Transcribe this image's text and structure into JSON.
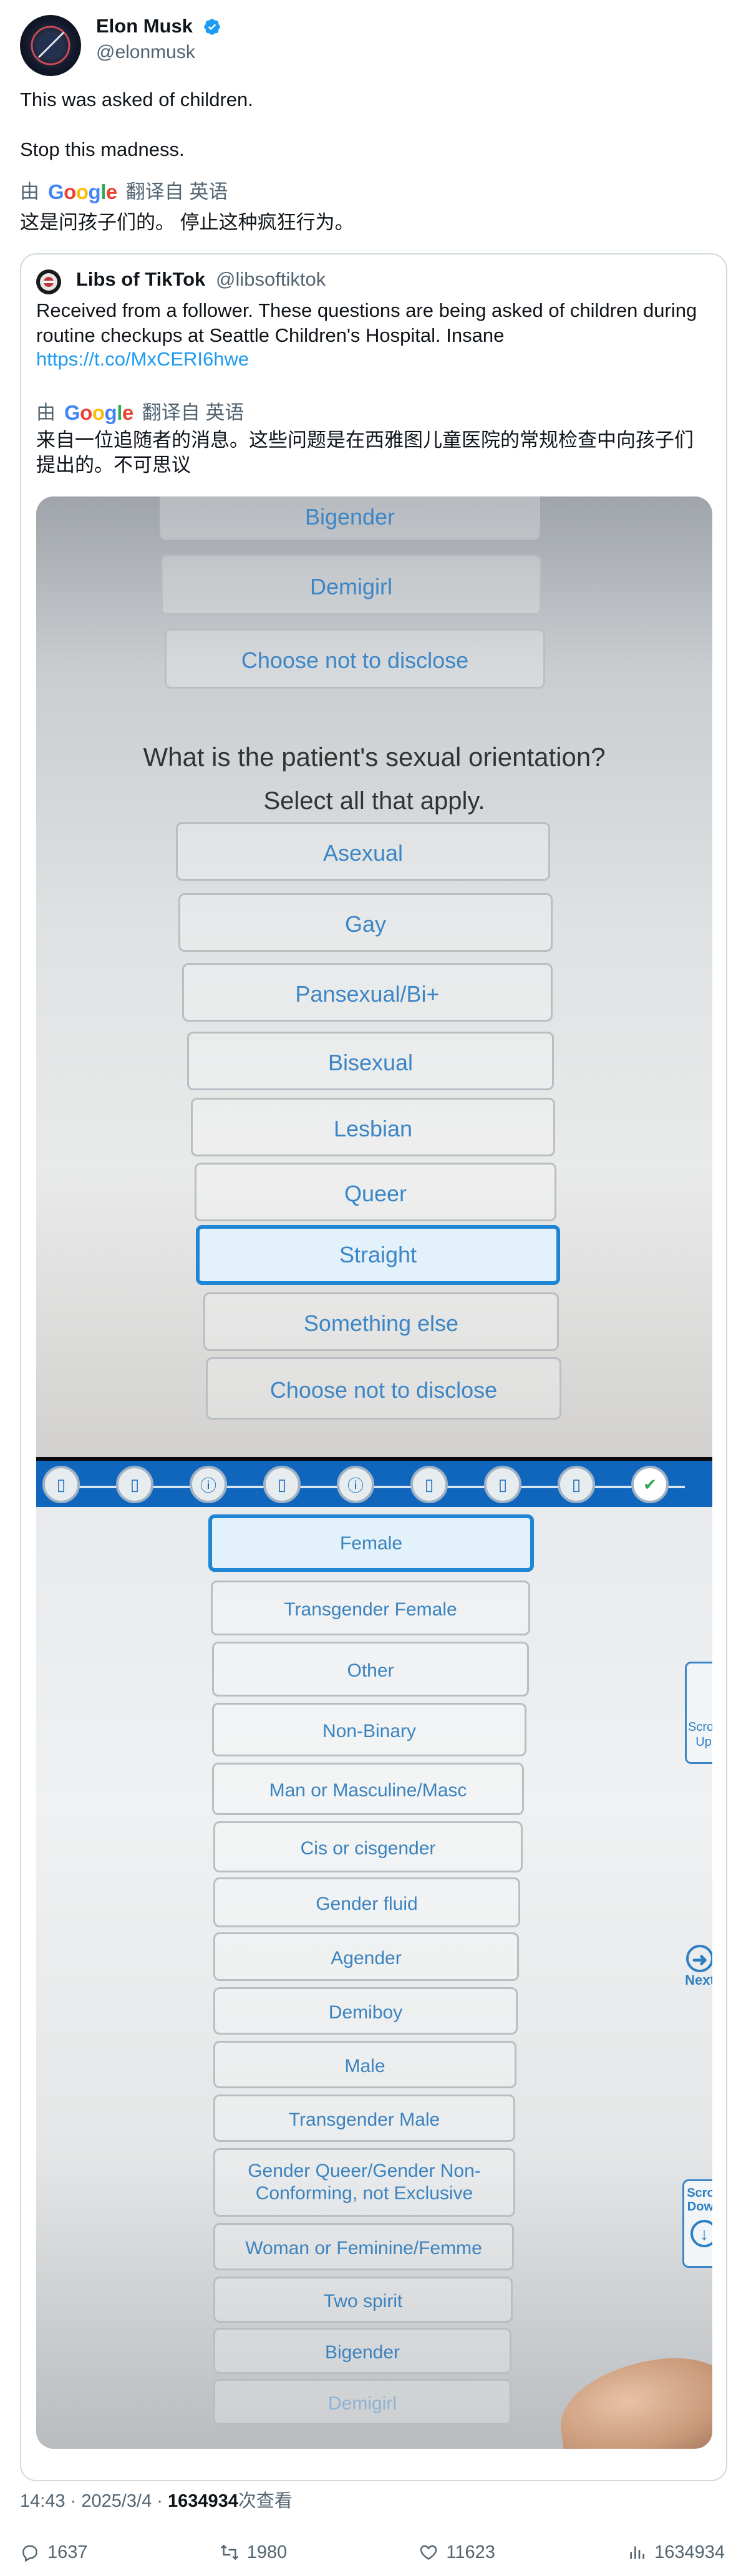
{
  "tweet": {
    "author_name": "Elon Musk",
    "author_handle": "@elonmusk",
    "text": "This was asked of children.\n\nStop this madness.",
    "translate_by": "由",
    "translate_provider": "Google",
    "translate_from": "翻译自 英语",
    "translated_text": "这是问孩子们的。 停止这种疯狂行为。",
    "timestamp": "14:43 · 2025/3/4 · ",
    "views_count": "1634934",
    "views_label": "次查看",
    "actions": {
      "replies": "1637",
      "reposts": "1980",
      "likes": "11623",
      "views": "1634934"
    },
    "colors": {
      "verified": "#1d9bf0",
      "link": "#1d9bf0",
      "muted": "#536471"
    }
  },
  "quote": {
    "author_name": "Libs of TikTok",
    "author_handle": "@libsoftiktok",
    "text": "Received from a follower. These questions are being asked of children during routine checkups at Seattle Children's Hospital. Insane",
    "link": "https://t.co/MxCERI6hwe",
    "translate_by": "由",
    "translate_provider": "Google",
    "translate_from": "翻译自 英语",
    "translated_text": "来自一位追随者的消息。这些问题是在西雅图儿童医院的常规检查中向孩子们提出的。不可思议"
  },
  "photo_top": {
    "options_above": [
      "Bigender",
      "Demigirl",
      "Choose not to disclose"
    ],
    "question": "What is the patient's sexual orientation?",
    "instruction": "Select all that apply.",
    "options": [
      "Asexual",
      "Gay",
      "Pansexual/Bi+",
      "Bisexual",
      "Lesbian",
      "Queer",
      "Straight",
      "Something else",
      "Choose not to disclose"
    ],
    "selected": "Straight"
  },
  "photo_bottom": {
    "options": [
      "Female",
      "Transgender Female",
      "Other",
      "Non-Binary",
      "Man or Masculine/Masc",
      "Cis or cisgender",
      "Gender fluid",
      "Agender",
      "Demiboy",
      "Male",
      "Transgender Male",
      "Gender Queer/Gender Non-Conforming, not Exclusive",
      "Woman or Feminine/Femme",
      "Two spirit",
      "Bigender",
      "Demigirl"
    ],
    "selected": "Female",
    "side_next": "Next",
    "side_scroll": "Scroll Down",
    "side_scroll_up": "Scroll Up"
  }
}
